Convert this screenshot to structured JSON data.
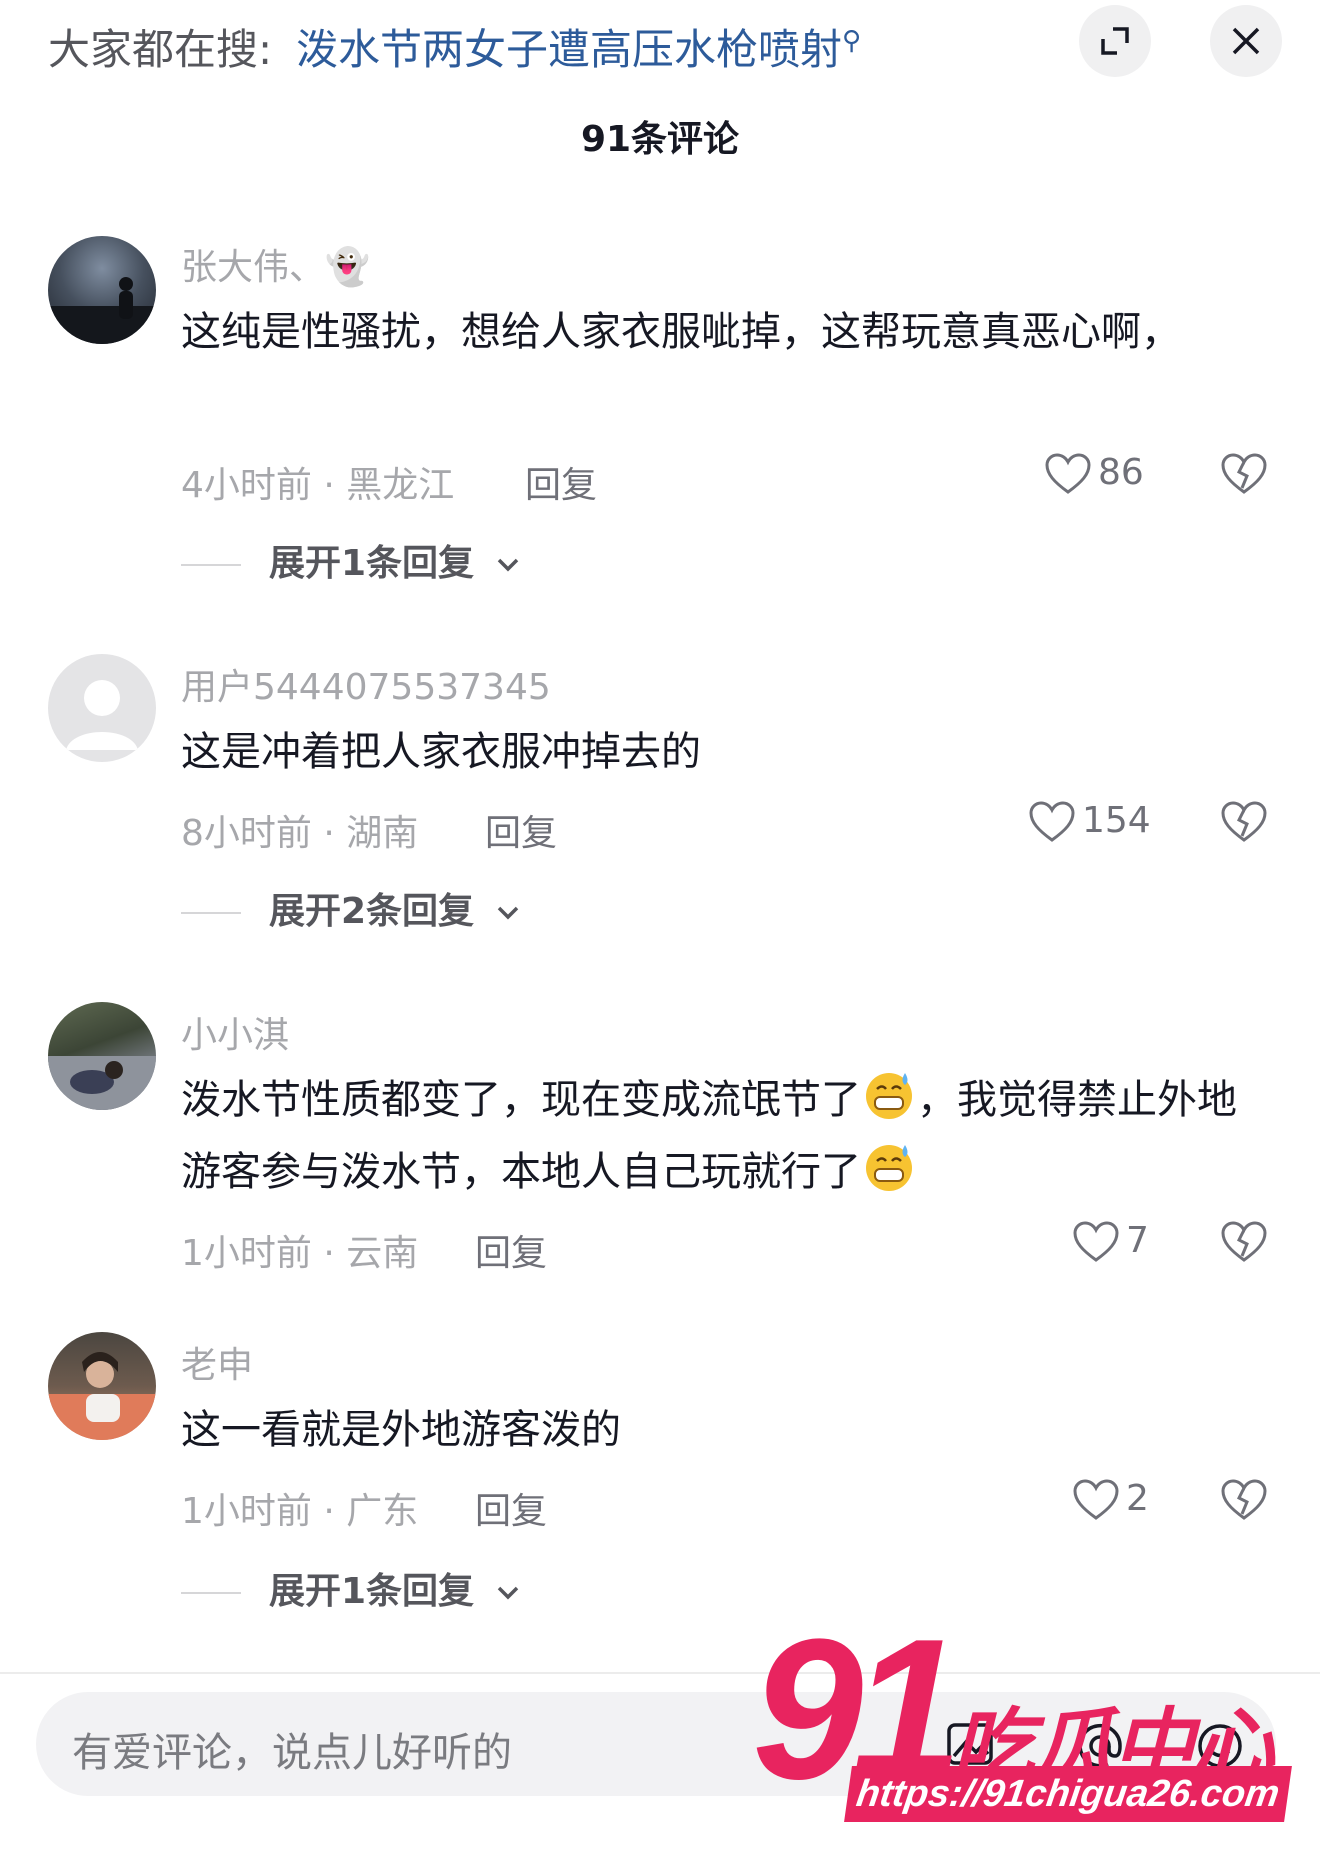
{
  "header": {
    "search_prefix": "大家都在搜:",
    "search_query": "泼水节两女子遭高压水枪喷射",
    "comment_count_title": "91条评论"
  },
  "comments": [
    {
      "username": "张大伟、👻",
      "text_html": "这纯是性骚扰，想给人家衣服呲掉，这帮玩意真恶心啊，",
      "meta": "4小时前 · 黑龙江",
      "reply_label": "回复",
      "likes": "86",
      "expand_label": "展开1条回复"
    },
    {
      "username": "用户5444075537345",
      "text_html": "这是冲着把人家衣服冲掉去的",
      "meta": "8小时前 · 湖南",
      "reply_label": "回复",
      "likes": "154",
      "expand_label": "展开2条回复"
    },
    {
      "username": "小小淇",
      "text_part1": "泼水节性质都变了，现在变成流氓节了",
      "text_part2": "，我觉得禁止外地游客参与泼水节，本地人自己玩就行了",
      "meta": "1小时前 · 云南",
      "reply_label": "回复",
      "likes": "7",
      "expand_label": ""
    },
    {
      "username": "老申",
      "text_html": "这一看就是外地游客泼的",
      "meta": "1小时前 · 广东",
      "reply_label": "回复",
      "likes": "2",
      "expand_label": "展开1条回复"
    }
  ],
  "input": {
    "placeholder": "有爱评论，说点儿好听的"
  },
  "watermark": {
    "number": "91",
    "title": "吃瓜中心",
    "url": "https://91chigua26.com"
  },
  "colors": {
    "link_blue": "#2d5b9a",
    "muted_gray": "#a6a7ab",
    "watermark_pink": "#e8245f"
  },
  "icons": [
    "search-icon",
    "expand-window-icon",
    "close-icon",
    "heart-icon",
    "broken-heart-icon",
    "chevron-down-icon",
    "image-icon",
    "at-icon",
    "emoji-icon",
    "grinning-sweat-emoji"
  ]
}
